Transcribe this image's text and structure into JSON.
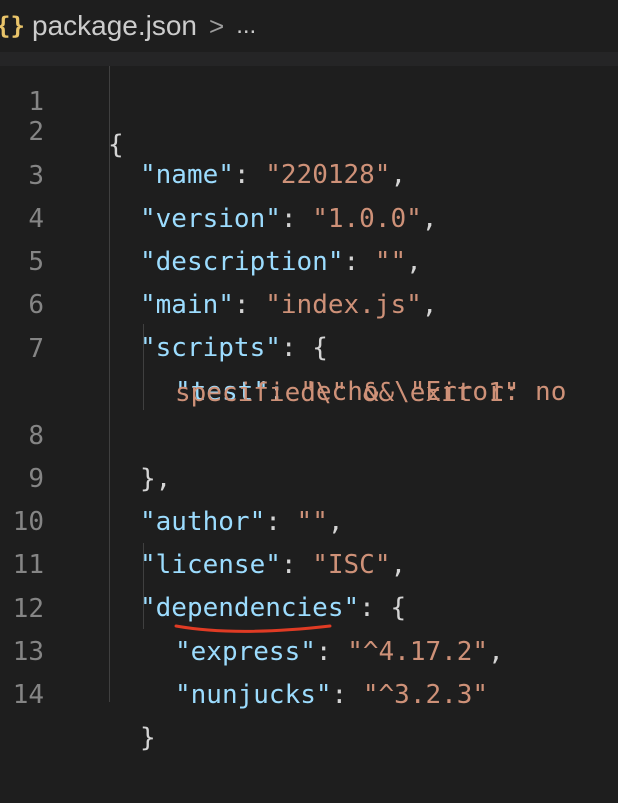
{
  "breadcrumb": {
    "icon": "{}",
    "file": "package.json",
    "separator": ">",
    "more": "..."
  },
  "colors": {
    "key": "#9cdcfe",
    "string": "#ce9178",
    "punct": "#d4d4d4",
    "line_number": "#858585",
    "annotation": "#e03b24"
  },
  "lines": {
    "l1": {
      "num": "1",
      "text": "{"
    },
    "l2": {
      "num": "2",
      "key": "\"name\"",
      "colon": ": ",
      "value": "\"220128\"",
      "end": ","
    },
    "l3": {
      "num": "3",
      "key": "\"version\"",
      "colon": ": ",
      "value": "\"1.0.0\"",
      "end": ","
    },
    "l4": {
      "num": "4",
      "key": "\"description\"",
      "colon": ": ",
      "value": "\"\"",
      "end": ","
    },
    "l5": {
      "num": "5",
      "key": "\"main\"",
      "colon": ": ",
      "value": "\"index.js\"",
      "end": ","
    },
    "l6": {
      "num": "6",
      "key": "\"scripts\"",
      "colon": ": ",
      "end": "{"
    },
    "l7": {
      "num": "7",
      "key": "\"test\"",
      "colon": ": ",
      "value": "\"echo \\\"Error: no"
    },
    "l7b": {
      "value": "specified\\\" && exit 1\""
    },
    "l8": {
      "num": "8",
      "text": "},"
    },
    "l9": {
      "num": "9",
      "key": "\"author\"",
      "colon": ": ",
      "value": "\"\"",
      "end": ","
    },
    "l10": {
      "num": "10",
      "key": "\"license\"",
      "colon": ": ",
      "value": "\"ISC\"",
      "end": ","
    },
    "l11": {
      "num": "11",
      "key": "\"dependencies\"",
      "colon": ": ",
      "end": "{"
    },
    "l12": {
      "num": "12",
      "key": "\"express\"",
      "colon": ": ",
      "value": "\"^4.17.2\"",
      "end": ","
    },
    "l13": {
      "num": "13",
      "key": "\"nunjucks\"",
      "colon": ": ",
      "value": "\"^3.2.3\""
    },
    "l14": {
      "num": "14",
      "text": "}"
    }
  }
}
